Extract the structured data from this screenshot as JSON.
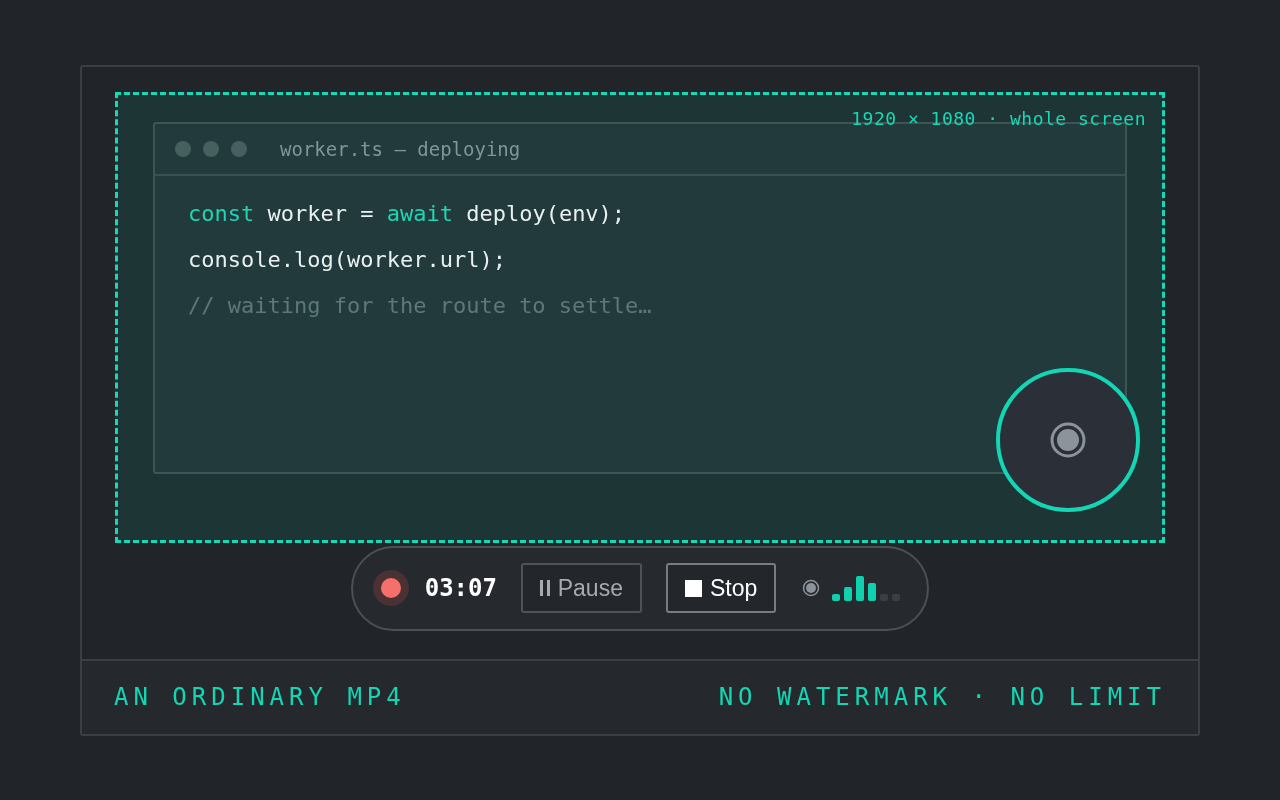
{
  "stage": {
    "label": "1920 × 1080 · whole screen"
  },
  "editor": {
    "title": "worker.ts — deploying",
    "lines": [
      [
        {
          "kind": "keyword",
          "text": "const"
        },
        {
          "kind": "plain",
          "text": " worker = "
        },
        {
          "kind": "keyword",
          "text": "await"
        },
        {
          "kind": "plain",
          "text": " deploy(env);"
        }
      ],
      [
        {
          "kind": "plain",
          "text": "console.log(worker.url);"
        }
      ],
      [
        {
          "kind": "comment",
          "text": "// waiting for the route to settle…"
        }
      ]
    ]
  },
  "recorder": {
    "recording": true,
    "time": "03:07",
    "buttons": [
      {
        "kind": "pause",
        "label": "Pause"
      },
      {
        "kind": "stop",
        "label": "Stop"
      }
    ],
    "mic": {
      "level": 0.67
    }
  },
  "footer": {
    "left": "AN ORDINARY MP4",
    "right": "NO WATERMARK · NO LIMIT"
  }
}
